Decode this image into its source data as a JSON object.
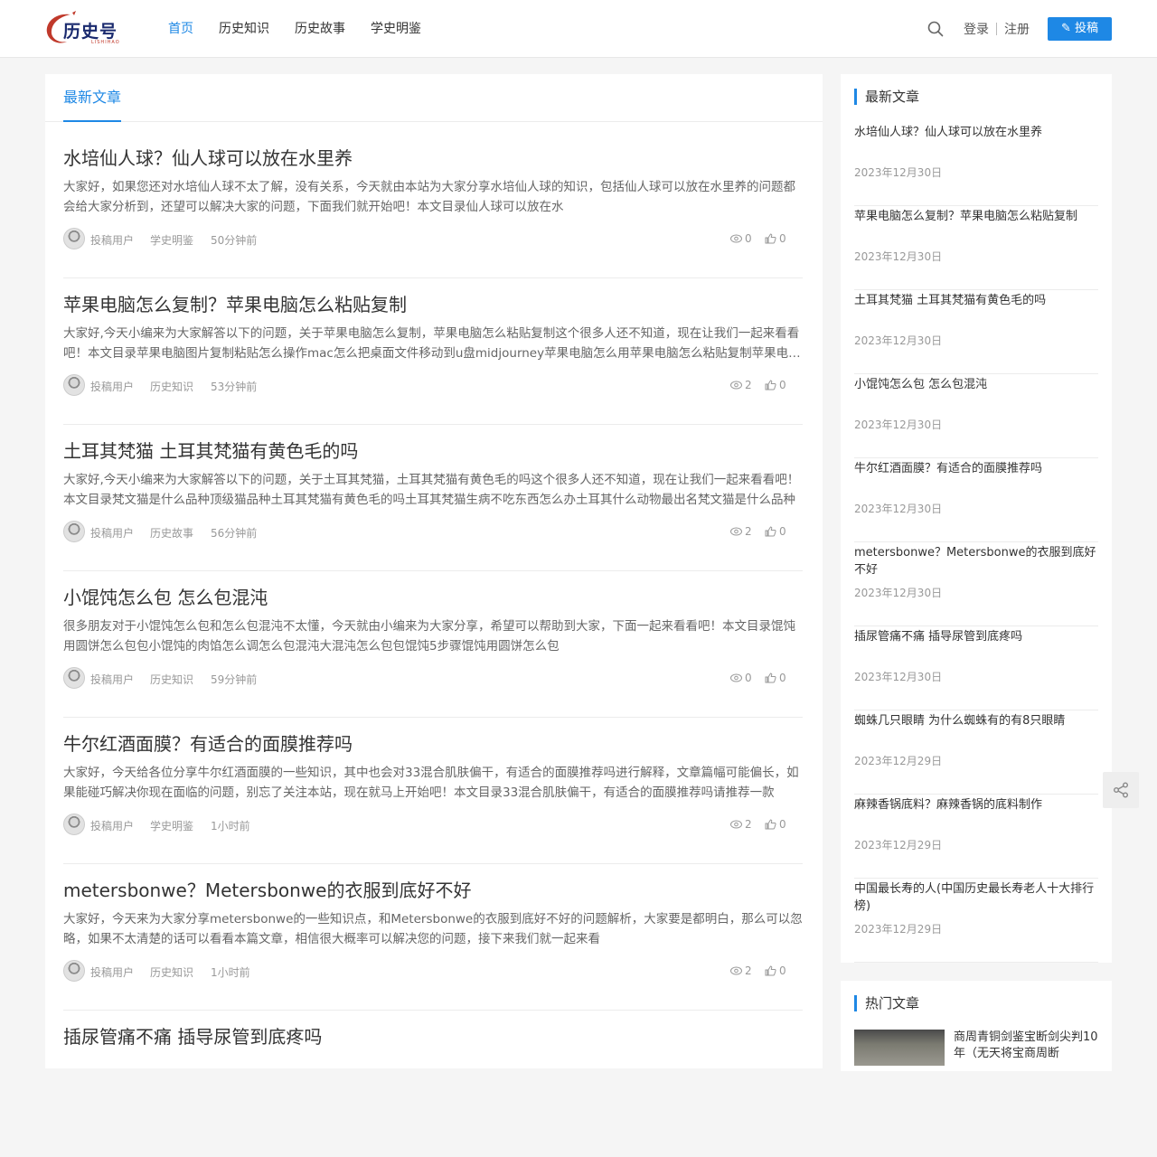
{
  "logo": {
    "text": "历史号",
    "sub": "LISHIHAO"
  },
  "nav": {
    "items": [
      "首页",
      "历史知识",
      "历史故事",
      "学史明鉴"
    ],
    "active_index": 0
  },
  "auth": {
    "login": "登录",
    "register": "注册"
  },
  "post_button": "投稿",
  "colors": {
    "accent": "#1e88e5"
  },
  "main": {
    "tab": "最新文章",
    "posts": [
      {
        "title": "水培仙人球？仙人球可以放在水里养",
        "excerpt": "大家好，如果您还对水培仙人球不太了解，没有关系，今天就由本站为大家分享水培仙人球的知识，包括仙人球可以放在水里养的问题都会给大家分析到，还望可以解决大家的问题，下面我们就开始吧！本文目录仙人球可以放在水",
        "author": "投稿用户",
        "category": "学史明鉴",
        "time": "50分钟前",
        "views": "0",
        "likes": "0"
      },
      {
        "title": "苹果电脑怎么复制？苹果电脑怎么粘贴复制",
        "excerpt": "大家好,今天小编来为大家解答以下的问题，关于苹果电脑怎么复制，苹果电脑怎么粘贴复制这个很多人还不知道，现在让我们一起来看看吧！本文目录苹果电脑图片复制粘贴怎么操作mac怎么把桌面文件移动到u盘midjourney苹果电脑怎么用苹果电脑怎么粘贴复制苹果电脑怎么复制粘贴",
        "author": "投稿用户",
        "category": "历史知识",
        "time": "53分钟前",
        "views": "2",
        "likes": "0"
      },
      {
        "title": "土耳其梵猫 土耳其梵猫有黄色毛的吗",
        "excerpt": "大家好,今天小编来为大家解答以下的问题，关于土耳其梵猫，土耳其梵猫有黄色毛的吗这个很多人还不知道，现在让我们一起来看看吧！本文目录梵文猫是什么品种顶级猫品种土耳其梵猫有黄色毛的吗土耳其梵猫生病不吃东西怎么办土耳其什么动物最出名梵文猫是什么品种",
        "author": "投稿用户",
        "category": "历史故事",
        "time": "56分钟前",
        "views": "2",
        "likes": "0"
      },
      {
        "title": "小馄饨怎么包 怎么包混沌",
        "excerpt": "很多朋友对于小馄饨怎么包和怎么包混沌不太懂，今天就由小编来为大家分享，希望可以帮助到大家，下面一起来看看吧！本文目录馄饨用圆饼怎么包包小馄饨的肉馅怎么调怎么包混沌大混沌怎么包包馄饨5步骤馄饨用圆饼怎么包",
        "author": "投稿用户",
        "category": "历史知识",
        "time": "59分钟前",
        "views": "0",
        "likes": "0"
      },
      {
        "title": "牛尔红酒面膜？有适合的面膜推荐吗",
        "excerpt": "大家好，今天给各位分享牛尔红酒面膜的一些知识，其中也会对33混合肌肤偏干，有适合的面膜推荐吗进行解释，文章篇幅可能偏长，如果能碰巧解决你现在面临的问题，别忘了关注本站，现在就马上开始吧！本文目录33混合肌肤偏干，有适合的面膜推荐吗请推荐一款",
        "author": "投稿用户",
        "category": "学史明鉴",
        "time": "1小时前",
        "views": "2",
        "likes": "0"
      },
      {
        "title": "metersbonwe？Metersbonwe的衣服到底好不好",
        "excerpt": "大家好，今天来为大家分享metersbonwe的一些知识点，和Metersbonwe的衣服到底好不好的问题解析，大家要是都明白，那么可以忽略，如果不太清楚的话可以看看本篇文章，相信很大概率可以解决您的问题，接下来我们就一起来看",
        "author": "投稿用户",
        "category": "历史知识",
        "time": "1小时前",
        "views": "2",
        "likes": "0"
      },
      {
        "title": "插尿管痛不痛 插导尿管到底疼吗",
        "excerpt": "",
        "author": "",
        "category": "",
        "time": "",
        "views": "",
        "likes": ""
      }
    ]
  },
  "sidebar": {
    "latest_heading": "最新文章",
    "latest": [
      {
        "title": "水培仙人球？仙人球可以放在水里养",
        "date": "2023年12月30日"
      },
      {
        "title": "苹果电脑怎么复制？苹果电脑怎么粘贴复制",
        "date": "2023年12月30日"
      },
      {
        "title": "土耳其梵猫 土耳其梵猫有黄色毛的吗",
        "date": "2023年12月30日"
      },
      {
        "title": "小馄饨怎么包 怎么包混沌",
        "date": "2023年12月30日"
      },
      {
        "title": "牛尔红酒面膜？有适合的面膜推荐吗",
        "date": "2023年12月30日"
      },
      {
        "title": "metersbonwe？Metersbonwe的衣服到底好不好",
        "date": "2023年12月30日"
      },
      {
        "title": "插尿管痛不痛 插导尿管到底疼吗",
        "date": "2023年12月30日"
      },
      {
        "title": "蜘蛛几只眼睛 为什么蜘蛛有的有8只眼睛",
        "date": "2023年12月29日"
      },
      {
        "title": "麻辣香锅底料？麻辣香锅的底料制作",
        "date": "2023年12月29日"
      },
      {
        "title": "中国最长寿的人(中国历史最长寿老人十大排行榜)",
        "date": "2023年12月29日"
      }
    ],
    "hot_heading": "热门文章",
    "hot": [
      {
        "title": "商周青铜剑鉴宝断剑尖判10年（无天将宝商周断"
      }
    ]
  }
}
